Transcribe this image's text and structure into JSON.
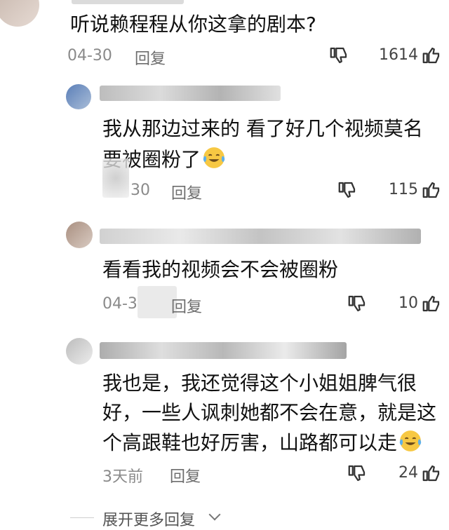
{
  "comments": [
    {
      "text_lines": [
        "听说赖程程从你这拿的剧本?"
      ],
      "date": "04-30",
      "reply_label": "回复",
      "likes": "1614"
    },
    {
      "text_lines": [
        "我从那边过来的 看了好几个视频莫名",
        "要被圈粉了"
      ],
      "date": "30",
      "reply_label": "回复",
      "likes": "115"
    },
    {
      "text_lines": [
        "看看我的视频会不会被圈粉"
      ],
      "date": "04-3",
      "reply_label": "回复",
      "likes": "10"
    },
    {
      "text_lines": [
        "我也是，我还觉得这个小姐姐脾气很",
        "好，一些人讽刺她都不会在意，就是这",
        "个高跟鞋也好厉害，山路都可以走"
      ],
      "date": "3天前",
      "reply_label": "回复",
      "likes": "24"
    }
  ],
  "expand_more_label": "展开更多回复",
  "icons": {
    "dislike": "thumbs-down-icon",
    "like": "thumbs-up-icon",
    "emoji": "tears-of-joy-emoji-icon",
    "expand": "chevron-down-icon"
  },
  "colors": {
    "text": "#111111",
    "meta": "#8a8a8a",
    "reply": "#6d6d6d",
    "emoji_face": "#f7c843"
  }
}
